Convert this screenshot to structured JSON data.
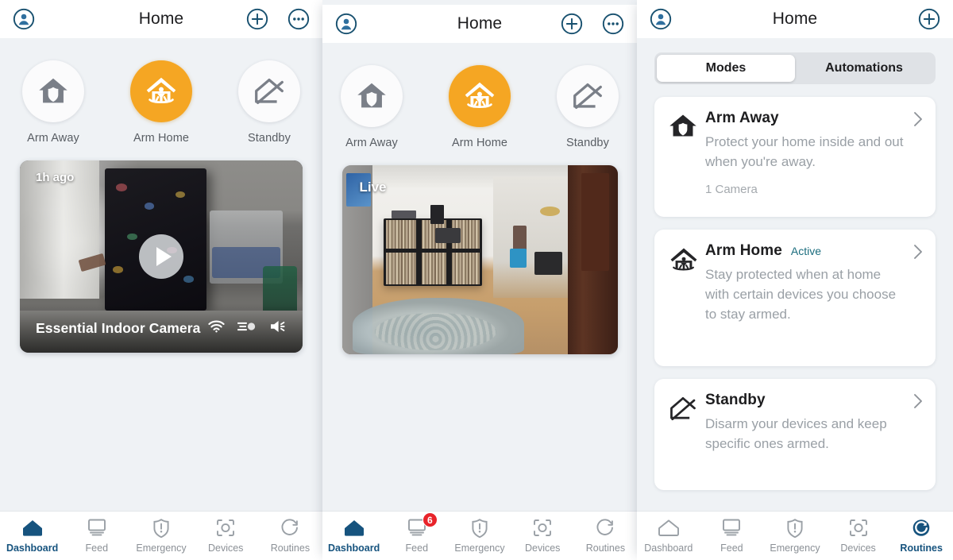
{
  "app": {
    "accent_blue": "#16537e",
    "accent_orange": "#f5a623",
    "badge_red": "#e8232a",
    "active_teal": "#1b6d7e",
    "bg": "#eff2f5"
  },
  "panel_left": {
    "header": {
      "title": "Home",
      "account_icon": "account-circle-icon",
      "add_icon": "plus-circle-icon",
      "more_icon": "more-circle-icon"
    },
    "modes": [
      {
        "label": "Arm Away",
        "icon": "house-shield-icon",
        "active": false
      },
      {
        "label": "Arm Home",
        "icon": "house-person-icon",
        "active": true
      },
      {
        "label": "Standby",
        "icon": "house-slash-icon",
        "active": false
      }
    ],
    "camera": {
      "time_label": "1h ago",
      "name": "Essential Indoor Camera",
      "play_icon": "play-icon",
      "icons": [
        "wifi-icon",
        "motion-spotlight-icon",
        "speaker-icon"
      ]
    },
    "nav": [
      {
        "label": "Dashboard",
        "icon": "home-icon",
        "active": true,
        "badge": ""
      },
      {
        "label": "Feed",
        "icon": "monitor-icon",
        "active": false,
        "badge": ""
      },
      {
        "label": "Emergency",
        "icon": "shield-alert-icon",
        "active": false,
        "badge": ""
      },
      {
        "label": "Devices",
        "icon": "devices-icon",
        "active": false,
        "badge": ""
      },
      {
        "label": "Routines",
        "icon": "routines-icon",
        "active": false,
        "badge": ""
      }
    ]
  },
  "panel_middle": {
    "header": {
      "title": "Home",
      "account_icon": "account-circle-icon",
      "add_icon": "plus-circle-icon",
      "more_icon": "more-circle-icon"
    },
    "modes": [
      {
        "label": "Arm Away",
        "icon": "house-shield-icon",
        "active": false
      },
      {
        "label": "Arm Home",
        "icon": "house-person-icon",
        "active": true
      },
      {
        "label": "Standby",
        "icon": "house-slash-icon",
        "active": false
      }
    ],
    "camera": {
      "live_label": "Live"
    },
    "nav": [
      {
        "label": "Dashboard",
        "icon": "home-icon",
        "active": true,
        "badge": ""
      },
      {
        "label": "Feed",
        "icon": "monitor-icon",
        "active": false,
        "badge": "6"
      },
      {
        "label": "Emergency",
        "icon": "shield-alert-icon",
        "active": false,
        "badge": ""
      },
      {
        "label": "Devices",
        "icon": "devices-icon",
        "active": false,
        "badge": ""
      },
      {
        "label": "Routines",
        "icon": "routines-icon",
        "active": false,
        "badge": ""
      }
    ]
  },
  "panel_right": {
    "header": {
      "title": "Home",
      "account_icon": "account-circle-icon",
      "add_icon": "plus-circle-icon"
    },
    "tabs": [
      {
        "label": "Modes",
        "selected": true
      },
      {
        "label": "Automations",
        "selected": false
      }
    ],
    "cards": [
      {
        "title": "Arm Away",
        "status": "",
        "description": "Protect your home inside and out when you're away.",
        "meta": "1 Camera",
        "icon": "house-shield-icon",
        "chevron": "chevron-right-icon"
      },
      {
        "title": "Arm Home",
        "status": "Active",
        "description": "Stay protected when at home with certain devices you choose to stay armed.",
        "meta": "",
        "icon": "house-person-icon",
        "chevron": "chevron-right-icon"
      },
      {
        "title": "Standby",
        "status": "",
        "description": "Disarm your devices and keep specific ones armed.",
        "meta": "",
        "icon": "house-slash-icon",
        "chevron": "chevron-right-icon"
      }
    ],
    "nav": [
      {
        "label": "Dashboard",
        "icon": "home-icon",
        "active": false,
        "badge": ""
      },
      {
        "label": "Feed",
        "icon": "monitor-icon",
        "active": false,
        "badge": ""
      },
      {
        "label": "Emergency",
        "icon": "shield-alert-icon",
        "active": false,
        "badge": ""
      },
      {
        "label": "Devices",
        "icon": "devices-icon",
        "active": false,
        "badge": ""
      },
      {
        "label": "Routines",
        "icon": "routines-icon",
        "active": true,
        "badge": ""
      }
    ]
  }
}
